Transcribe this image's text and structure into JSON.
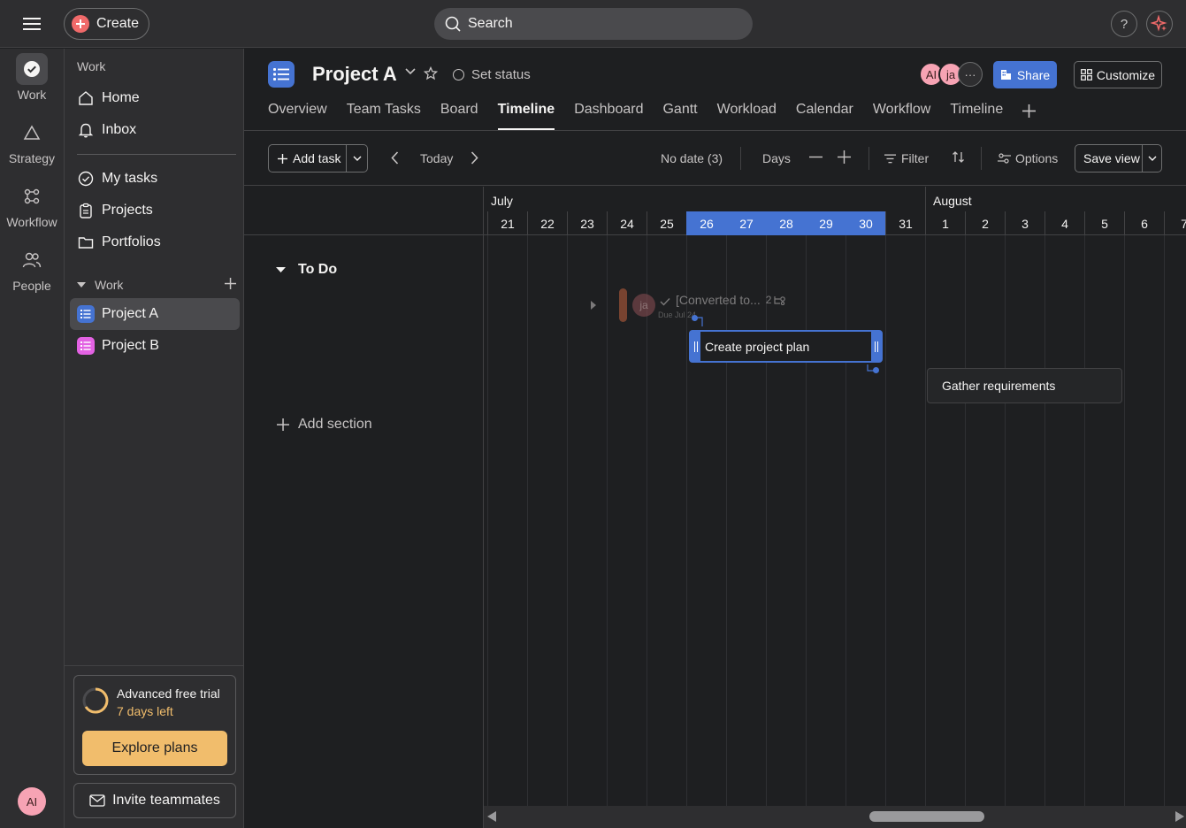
{
  "topbar": {
    "create_label": "Create",
    "search_placeholder": "Search",
    "help_label": "?"
  },
  "rail": {
    "items": [
      {
        "label": "Work",
        "icon": "check-circle-icon",
        "active": true
      },
      {
        "label": "Strategy",
        "icon": "triangle-icon"
      },
      {
        "label": "Workflow",
        "icon": "workflow-icon"
      },
      {
        "label": "People",
        "icon": "people-icon"
      }
    ],
    "avatar_initials": "AI"
  },
  "sidebar": {
    "heading": "Work",
    "nav": [
      {
        "label": "Home",
        "icon": "home-icon"
      },
      {
        "label": "Inbox",
        "icon": "bell-icon"
      }
    ],
    "links": [
      {
        "label": "My tasks",
        "icon": "check-circle-icon"
      },
      {
        "label": "Projects",
        "icon": "clipboard-icon"
      },
      {
        "label": "Portfolios",
        "icon": "folder-icon"
      }
    ],
    "section_label": "Work",
    "projects": [
      {
        "label": "Project A",
        "color": "#4573d2",
        "selected": true
      },
      {
        "label": "Project B",
        "color": "#e362e3"
      }
    ],
    "trial": {
      "title": "Advanced free trial",
      "days_left": "7 days left",
      "explore_label": "Explore plans"
    },
    "invite_label": "Invite teammates"
  },
  "project": {
    "title": "Project A",
    "set_status_label": "Set status",
    "members": [
      {
        "initials": "AI",
        "color": "#f7a3b4"
      },
      {
        "initials": "ja",
        "color": "#f7a3b4"
      }
    ],
    "more_members_label": "···",
    "share_label": "Share",
    "customize_label": "Customize",
    "tabs": [
      {
        "label": "Overview"
      },
      {
        "label": "Team Tasks"
      },
      {
        "label": "Board"
      },
      {
        "label": "Timeline",
        "active": true
      },
      {
        "label": "Dashboard"
      },
      {
        "label": "Gantt"
      },
      {
        "label": "Workload"
      },
      {
        "label": "Calendar"
      },
      {
        "label": "Workflow"
      },
      {
        "label": "Timeline"
      }
    ]
  },
  "toolbar": {
    "add_task_label": "Add task",
    "today_label": "Today",
    "no_date_label": "No date (3)",
    "days_label": "Days",
    "filter_label": "Filter",
    "options_label": "Options",
    "save_view_label": "Save view"
  },
  "timeline": {
    "months": [
      "July",
      "August"
    ],
    "days": [
      "21",
      "22",
      "23",
      "24",
      "25",
      "26",
      "27",
      "28",
      "29",
      "30",
      "31",
      "1",
      "2",
      "3",
      "4",
      "5",
      "6",
      "7"
    ],
    "selected_days": [
      "26",
      "27",
      "28",
      "29",
      "30"
    ],
    "section_label": "To Do",
    "add_section_label": "Add section",
    "ghost_task": {
      "assignee": "ja",
      "title": "[Converted to...",
      "due": "Due Jul 24",
      "subtasks": "2"
    },
    "tasks": [
      {
        "label": "Create project plan"
      },
      {
        "label": "Gather requirements"
      }
    ]
  }
}
